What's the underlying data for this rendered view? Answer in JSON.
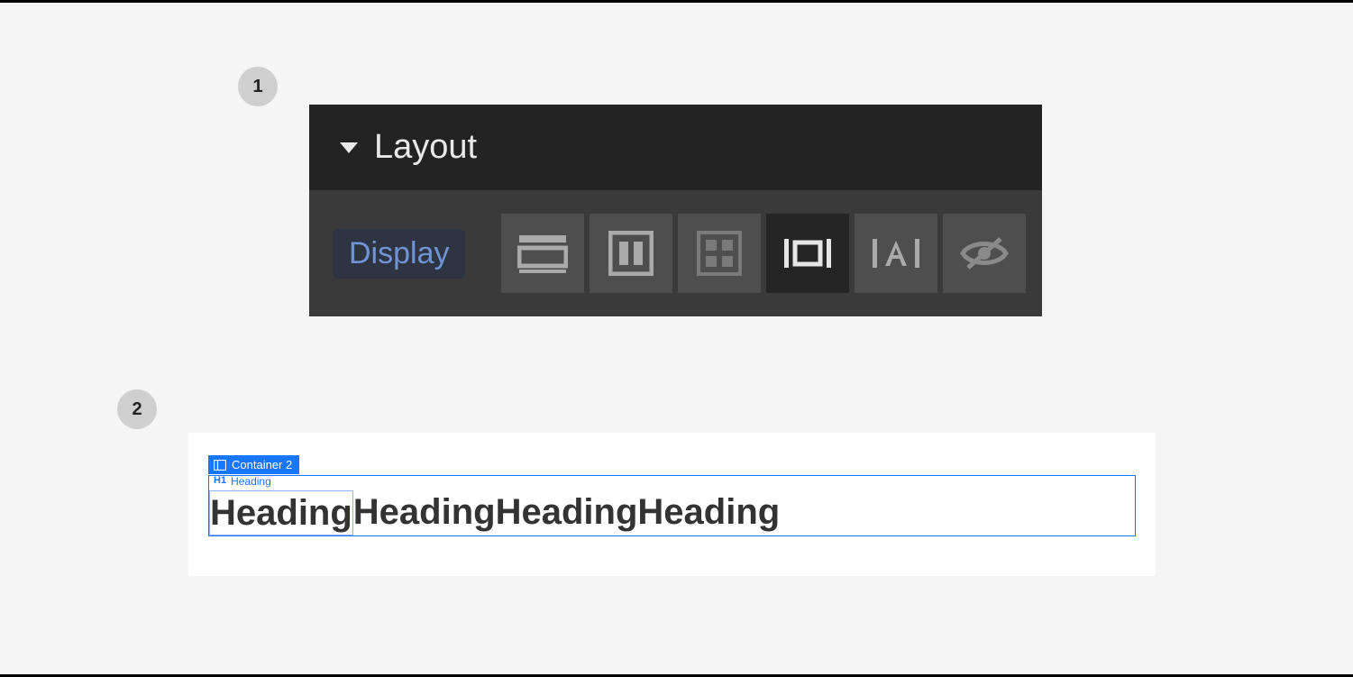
{
  "steps": {
    "one": "1",
    "two": "2"
  },
  "panel": {
    "title": "Layout",
    "display_label": "Display",
    "options": [
      {
        "name": "display-block"
      },
      {
        "name": "display-flex"
      },
      {
        "name": "display-grid"
      },
      {
        "name": "display-inline-block",
        "active": true
      },
      {
        "name": "display-inline"
      },
      {
        "name": "display-none"
      }
    ]
  },
  "canvas": {
    "container_label": "Container 2",
    "heading_tag_prefix": "H1",
    "heading_tag_label": "Heading",
    "headings": [
      "Heading",
      "Heading",
      "Heading",
      "Heading"
    ]
  }
}
